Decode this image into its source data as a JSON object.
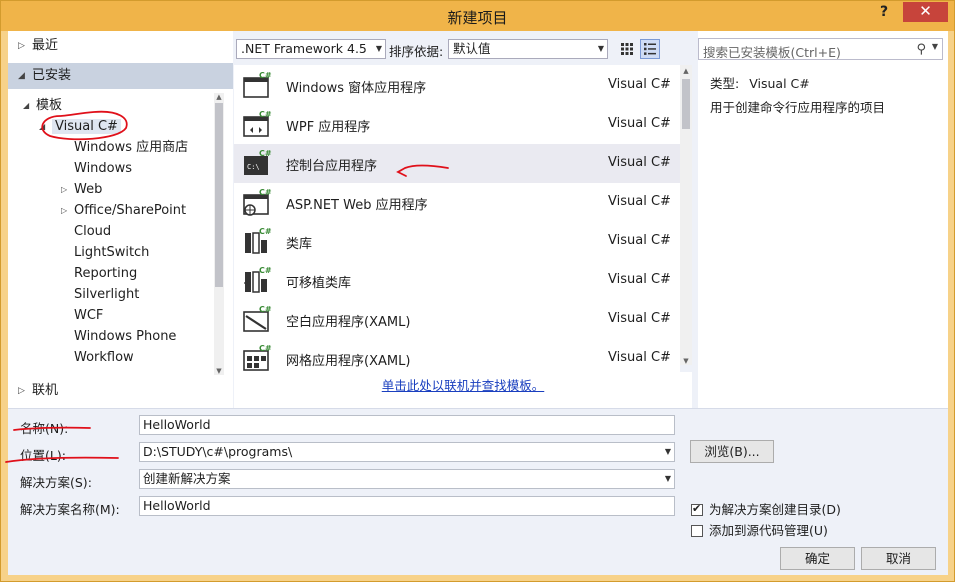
{
  "window": {
    "title": "新建项目",
    "help_label": "?",
    "close_label": "✕"
  },
  "left": {
    "recent": "最近",
    "installed": "已安装",
    "templates": "模板",
    "language": "Visual C#",
    "nodes": [
      "Windows 应用商店",
      "Windows",
      "Web",
      "Office/SharePoint",
      "Cloud",
      "LightSwitch",
      "Reporting",
      "Silverlight",
      "WCF",
      "Windows Phone",
      "Workflow"
    ],
    "online": "联机"
  },
  "toolbar": {
    "framework": ".NET Framework 4.5",
    "sort_label": "排序依据:",
    "sort_value": "默认值"
  },
  "templates": [
    {
      "name": "Windows 窗体应用程序",
      "lang": "Visual C#",
      "icon": "windows-forms-icon"
    },
    {
      "name": "WPF 应用程序",
      "lang": "Visual C#",
      "icon": "wpf-icon"
    },
    {
      "name": "控制台应用程序",
      "lang": "Visual C#",
      "icon": "console-icon"
    },
    {
      "name": "ASP.NET Web 应用程序",
      "lang": "Visual C#",
      "icon": "aspnet-icon"
    },
    {
      "name": "类库",
      "lang": "Visual C#",
      "icon": "class-library-icon"
    },
    {
      "name": "可移植类库",
      "lang": "Visual C#",
      "icon": "portable-library-icon"
    },
    {
      "name": "空白应用程序(XAML)",
      "lang": "Visual C#",
      "icon": "blank-app-icon"
    },
    {
      "name": "网格应用程序(XAML)",
      "lang": "Visual C#",
      "icon": "grid-app-icon"
    }
  ],
  "online_link": "单击此处以联机并查找模板。",
  "search": {
    "placeholder": "搜索已安装模板(Ctrl+E)"
  },
  "info": {
    "type_label": "类型:",
    "type_value": "Visual C#",
    "description": "用于创建命令行应用程序的项目"
  },
  "form": {
    "name_label": "名称(N):",
    "name_value": "HelloWorld",
    "location_label": "位置(L):",
    "location_value": "D:\\STUDY\\c#\\programs\\",
    "browse": "浏览(B)...",
    "solution_label": "解决方案(S):",
    "solution_value": "创建新解决方案",
    "solution_name_label": "解决方案名称(M):",
    "solution_name_value": "HelloWorld",
    "create_dir_label": "为解决方案创建目录(D)",
    "create_dir_checked": true,
    "source_control_label": "添加到源代码管理(U)",
    "source_control_checked": false,
    "ok": "确定",
    "cancel": "取消"
  },
  "colors": {
    "title_bar": "#f0b449",
    "close": "#c7443b",
    "selection": "#c9d2e0",
    "link": "#1a3fbf",
    "annotation": "#e0101a"
  }
}
